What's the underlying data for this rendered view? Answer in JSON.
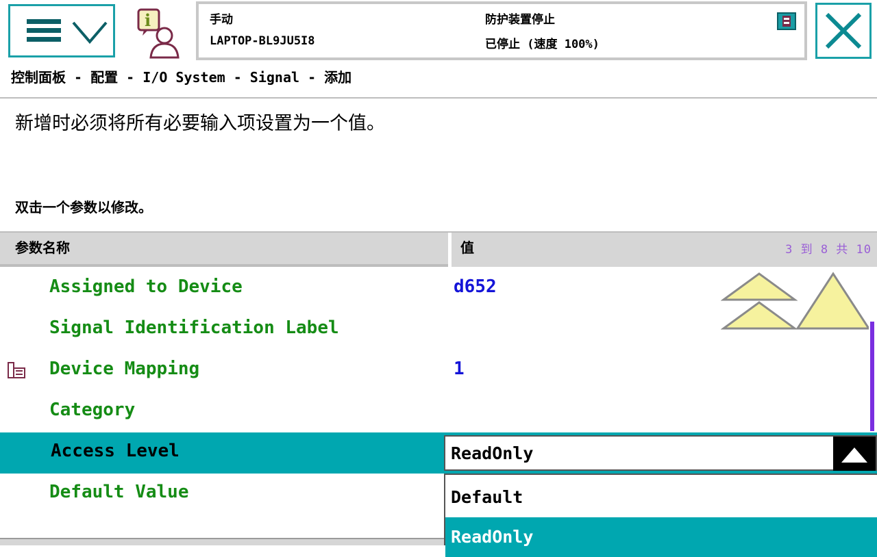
{
  "status": {
    "mode": "手动",
    "controller": "LAPTOP-BL9JU5I8",
    "safety": "防护装置停止",
    "state": "已停止 (速度 100%)"
  },
  "breadcrumb": "控制面板 - 配置 - I/O System - Signal - 添加",
  "instruction": "新增时必须将所有必要输入项设置为一个值。",
  "hint": "双击一个参数以修改。",
  "table": {
    "header_name": "参数名称",
    "header_value": "值",
    "page_indicator": "3 到 8 共 10",
    "rows": [
      {
        "name": "Assigned to Device",
        "value": "d652"
      },
      {
        "name": "Signal Identification Label",
        "value": ""
      },
      {
        "name": "Device Mapping",
        "value": "1"
      },
      {
        "name": "Category",
        "value": ""
      },
      {
        "name": "Access Level",
        "value": "ReadOnly"
      },
      {
        "name": "Default Value",
        "value": ""
      }
    ]
  },
  "dropdown": {
    "selected": "ReadOnly",
    "options": [
      "Default",
      "ReadOnly"
    ],
    "active_option": "ReadOnly"
  },
  "colors": {
    "accent": "#00a7b0",
    "param_name": "#158c15",
    "param_value": "#1414d8",
    "scrollbar": "#7a2fe0"
  },
  "icons": [
    "menu-icon",
    "chevron-down-icon",
    "info-user-icon",
    "stop-indicator-icon",
    "close-icon",
    "device-mapping-icon",
    "scroll-up-icon",
    "page-up-icon",
    "dropdown-up-icon"
  ]
}
